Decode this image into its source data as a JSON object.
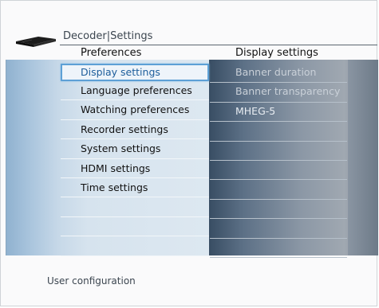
{
  "header": {
    "app": "Decoder",
    "separator": "|",
    "section": "Settings"
  },
  "columns": {
    "left_title": "Preferences",
    "right_title": "Display settings"
  },
  "preferences": [
    {
      "label": "Display settings",
      "selected": true
    },
    {
      "label": "Language preferences",
      "selected": false
    },
    {
      "label": "Watching preferences",
      "selected": false
    },
    {
      "label": "Recorder settings",
      "selected": false
    },
    {
      "label": "System settings",
      "selected": false
    },
    {
      "label": "HDMI settings",
      "selected": false
    },
    {
      "label": "Time settings",
      "selected": false
    }
  ],
  "display_settings": [
    {
      "label": "Banner duration"
    },
    {
      "label": "Banner transparency"
    },
    {
      "label": "MHEG-5"
    }
  ],
  "footer": {
    "hint": "User configuration"
  },
  "colors": {
    "selection_border": "#5da0d6",
    "selection_text": "#1d5d9b"
  }
}
